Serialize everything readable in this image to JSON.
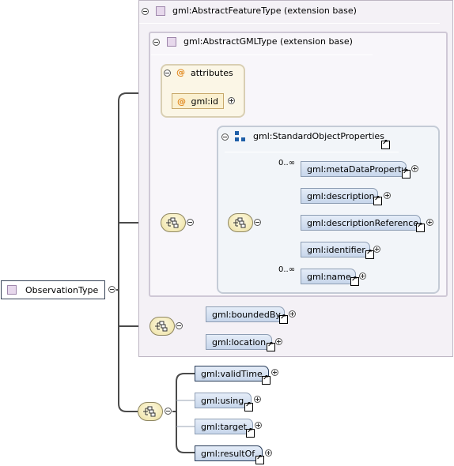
{
  "root": {
    "label": "ObservationType"
  },
  "extension_outer": {
    "title": "gml:AbstractFeatureType (extension base)"
  },
  "extension_inner": {
    "title": "gml:AbstractGMLType (extension base)"
  },
  "attributes_group": {
    "title": "attributes",
    "items": [
      {
        "label": "gml:id"
      }
    ]
  },
  "property_group": {
    "title": "gml:StandardObjectProperties",
    "elements": [
      {
        "label": "gml:metaDataProperty",
        "cardinality": "0..∞"
      },
      {
        "label": "gml:description"
      },
      {
        "label": "gml:descriptionReference"
      },
      {
        "label": "gml:identifier"
      },
      {
        "label": "gml:name",
        "cardinality": "0..∞"
      }
    ]
  },
  "feature_elements": [
    {
      "label": "gml:boundedBy"
    },
    {
      "label": "gml:location"
    }
  ],
  "observation_elements": [
    {
      "label": "gml:validTime"
    },
    {
      "label": "gml:using"
    },
    {
      "label": "gml:target"
    },
    {
      "label": "gml:resultOf"
    }
  ]
}
